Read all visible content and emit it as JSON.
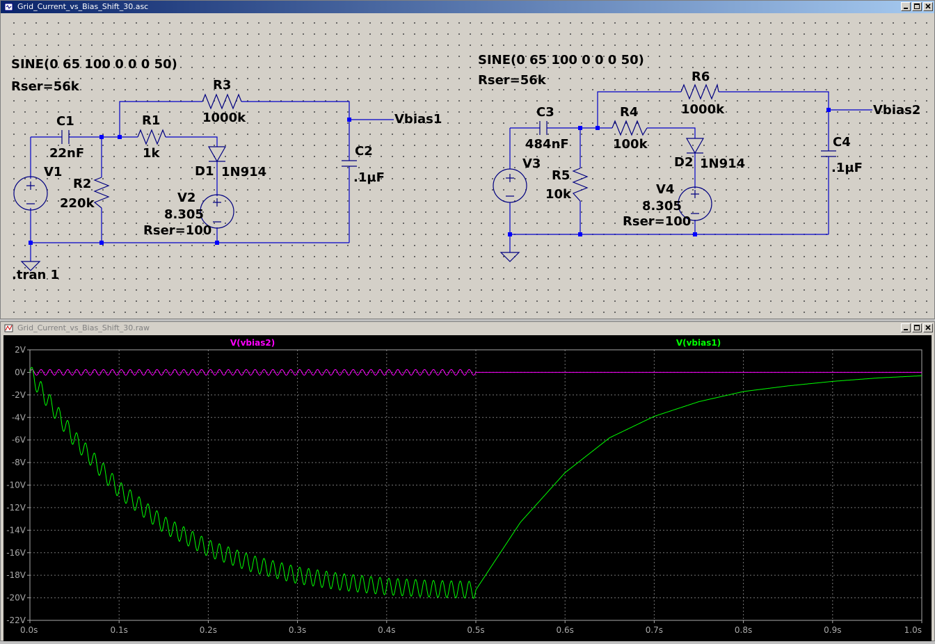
{
  "schematic_window": {
    "title": "Grid_Current_vs_Bias_Shift_30.asc",
    "circuit1": {
      "source_spec": "SINE(0 65 100 0 0 0 50)",
      "rser": "Rser=56k",
      "c1": "C1",
      "c1_val": "22nF",
      "r1": "R1",
      "r1_val": "1k",
      "r2": "R2",
      "r2_val": "220k",
      "r3": "R3",
      "r3_val": "1000k",
      "c2": "C2",
      "c2_val": ".1µF",
      "d1": "D1",
      "d1_val": "1N914",
      "v1": "V1",
      "v2": "V2",
      "v2_val": "8.305",
      "v2_rser": "Rser=100",
      "net": "Vbias1",
      "directive": ".tran 1"
    },
    "circuit2": {
      "source_spec": "SINE(0 65 100 0 0 0 50)",
      "rser": "Rser=56k",
      "c3": "C3",
      "c3_val": "484nF",
      "r4": "R4",
      "r4_val": "100k",
      "r5": "R5",
      "r5_val": "10k",
      "r6": "R6",
      "r6_val": "1000k",
      "c4": "C4",
      "c4_val": ".1µF",
      "d2": "D2",
      "d2_val": "1N914",
      "v3": "V3",
      "v4": "V4",
      "v4_val": "8.305",
      "v4_rser": "Rser=100",
      "net": "Vbias2"
    }
  },
  "plot_window": {
    "title": "Grid_Current_vs_Bias_Shift_30.raw"
  },
  "colors": {
    "wire": "#0000c8",
    "component": "#000080",
    "node": "#0000ff",
    "vbias1": "#00ff00",
    "vbias2": "#ff00ff",
    "grid": "#777777",
    "plot_bg": "#000000"
  },
  "chart_data": {
    "type": "line",
    "x_unit": "s",
    "xlim": [
      0,
      1.0
    ],
    "ylim": [
      -22,
      2
    ],
    "x_ticks": [
      "0.0s",
      "0.1s",
      "0.2s",
      "0.3s",
      "0.4s",
      "0.5s",
      "0.6s",
      "0.7s",
      "0.8s",
      "0.9s",
      "1.0s"
    ],
    "y_ticks": [
      "2V",
      "0V",
      "-2V",
      "-4V",
      "-6V",
      "-8V",
      "-10V",
      "-12V",
      "-14V",
      "-16V",
      "-18V",
      "-20V",
      "-22V"
    ],
    "grid": true,
    "series": [
      {
        "name": "V(vbias2)",
        "color": "#ff00ff",
        "x": [
          0,
          0.5,
          0.55,
          1.0
        ],
        "y": [
          0,
          0,
          0,
          0
        ],
        "ripple_amplitude_until_0_5s": 0.25
      },
      {
        "name": "V(vbias1)",
        "color": "#00ff00",
        "x": [
          0,
          0.01,
          0.05,
          0.1,
          0.15,
          0.2,
          0.25,
          0.3,
          0.35,
          0.4,
          0.45,
          0.5,
          0.55,
          0.6,
          0.65,
          0.7,
          0.75,
          0.8,
          0.85,
          0.9,
          0.95,
          1.0
        ],
        "y": [
          0,
          -1.3,
          -5.9,
          -10.4,
          -13.5,
          -15.6,
          -17.0,
          -18.0,
          -18.6,
          -19.0,
          -19.2,
          -19.3,
          -13.3,
          -8.9,
          -5.8,
          -3.9,
          -2.6,
          -1.7,
          -1.2,
          -0.8,
          -0.5,
          -0.3
        ],
        "ripple_amplitude_until_0_5s": 0.75
      }
    ]
  }
}
